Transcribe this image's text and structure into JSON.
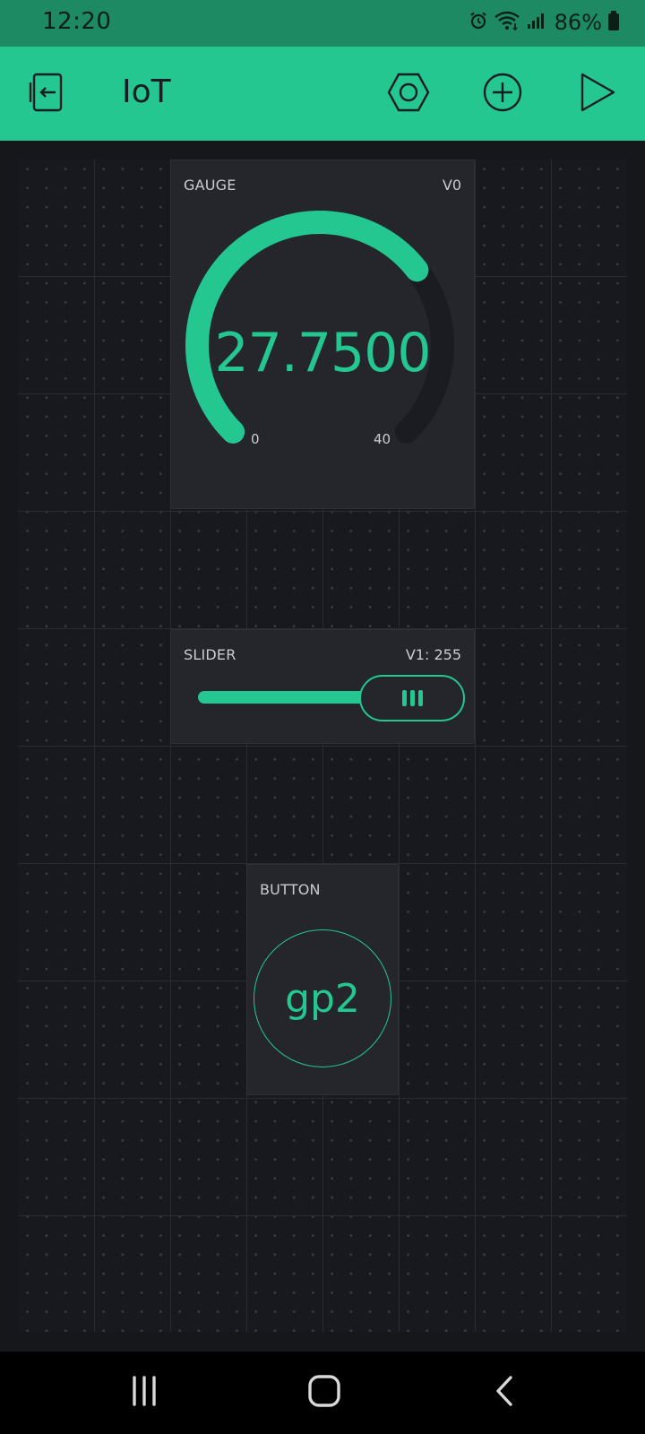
{
  "status_bar": {
    "time": "12:20",
    "battery": "86%",
    "icons": [
      "alarm-icon",
      "wifi-icon",
      "signal-icon",
      "battery-icon"
    ]
  },
  "app_bar": {
    "title": "IoT",
    "buttons": [
      "exit-icon",
      "settings-hexagon-icon",
      "add-widget-icon",
      "play-icon"
    ]
  },
  "colors": {
    "accent": "#25c790",
    "status": "#1d8a63",
    "widget": "#24262c",
    "background": "#16171b"
  },
  "gauge": {
    "label": "GAUGE",
    "pin": "V0",
    "value": "27.7500",
    "min": "0",
    "max": "40",
    "level": 0.69375
  },
  "slider": {
    "label": "SLIDER",
    "pin": "V1: 255",
    "level": 1.0
  },
  "button": {
    "label": "BUTTON",
    "text": "gp2"
  },
  "nav": {
    "buttons": [
      "recent-apps-icon",
      "home-icon",
      "back-icon"
    ]
  }
}
